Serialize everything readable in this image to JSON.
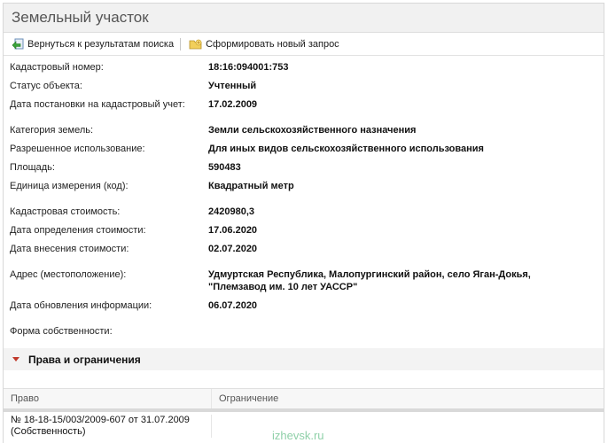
{
  "window": {
    "title": "Земельный участок"
  },
  "toolbar": {
    "back_label": "Вернуться к результатам поиска",
    "new_request_label": "Сформировать новый запрос"
  },
  "properties": [
    {
      "label": "Кадастровый номер:",
      "value": "18:16:094001:753"
    },
    {
      "label": "Статус объекта:",
      "value": "Учтенный"
    },
    {
      "label": "Дата постановки на кадастровый учет:",
      "value": "17.02.2009"
    },
    {
      "label": "Категория земель:",
      "value": "Земли сельскохозяйственного назначения"
    },
    {
      "label": "Разрешенное использование:",
      "value": "Для иных видов сельскохозяйственного использования"
    },
    {
      "label": "Площадь:",
      "value": "590483"
    },
    {
      "label": "Единица измерения (код):",
      "value": "Квадратный метр"
    },
    {
      "label": "Кадастровая стоимость:",
      "value": "2420980,3"
    },
    {
      "label": "Дата определения стоимости:",
      "value": "17.06.2020"
    },
    {
      "label": "Дата внесения стоимости:",
      "value": "02.07.2020"
    },
    {
      "label": "Адрес (местоположение):",
      "value_line1": "Удмуртская Республика, Малопургинский район, село Яган-Докья,",
      "value_line2": "\"Племзавод им. 10 лет УАССР\""
    },
    {
      "label": "Дата обновления информации:",
      "value": "06.07.2020"
    },
    {
      "label": "Форма собственности:",
      "value": ""
    }
  ],
  "rights_section": {
    "title": "Права и ограничения",
    "columns": {
      "right": "Право",
      "limitation": "Ограничение"
    },
    "rows": [
      {
        "right_line1": "№ 18-18-15/003/2009-607  от 31.07.2009",
        "right_line2": "(Собственность)",
        "limitation": ""
      }
    ]
  },
  "watermark": "izhevsk.ru"
}
